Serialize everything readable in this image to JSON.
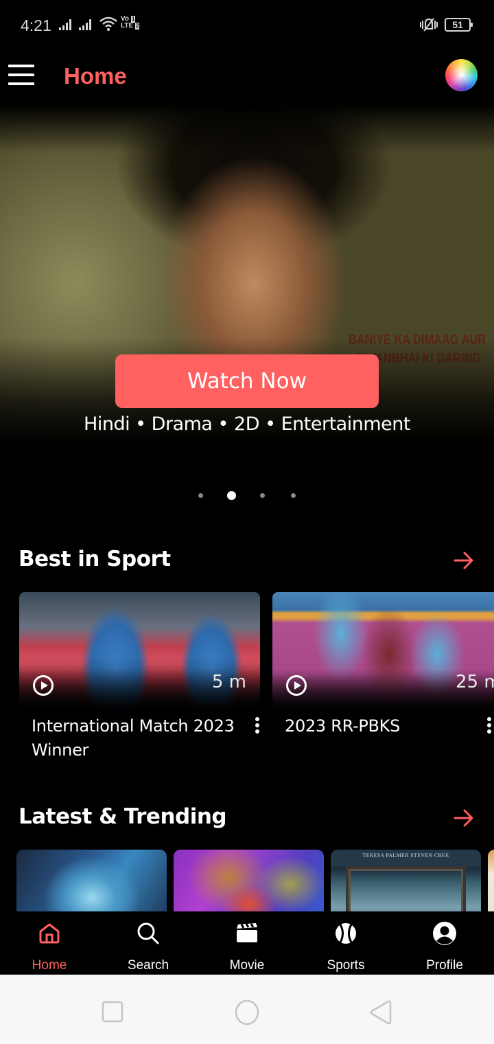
{
  "status_bar": {
    "time": "4:21",
    "volte_top": "Vo",
    "volte_bottom": "LTE",
    "sim_labels": [
      "1",
      "2"
    ],
    "battery": "51",
    "icons": [
      "signal-sim1-icon",
      "signal-sim2-icon",
      "wifi-icon",
      "volte-icon",
      "vibrate-icon",
      "battery-icon"
    ]
  },
  "app_bar": {
    "title": "Home",
    "menu_icon": "hamburger-menu-icon",
    "theme_icon": "color-wheel-icon"
  },
  "hero": {
    "poster_text_line1": "BANIYE KA DIMAAG AUR",
    "poster_text_line2": "MIYANBHAI KI DARING",
    "watch_button": "Watch Now",
    "meta": "Hindi • Drama • 2D • Entertainment",
    "carousel": {
      "total": 4,
      "active_index": 1
    }
  },
  "sections": {
    "best_in_sport": {
      "title": "Best in Sport",
      "see_all_icon": "arrow-right-icon",
      "items": [
        {
          "title": "International Match 2023 Winner",
          "duration": "5 m"
        },
        {
          "title": "2023 RR-PBKS",
          "duration": "25 m"
        }
      ]
    },
    "latest_trending": {
      "title": "Latest & Trending",
      "see_all_icon": "arrow-right-icon",
      "items": [
        {
          "poster": "avatar-poster"
        },
        {
          "poster": "mario-poster"
        },
        {
          "poster": "horror-poster",
          "credits": "TERESA PALMER    STEVEN CREE"
        },
        {
          "poster": "partial-poster"
        }
      ]
    }
  },
  "bottom_nav": {
    "active": "Home",
    "items": [
      {
        "label": "Home",
        "icon": "home-icon"
      },
      {
        "label": "Search",
        "icon": "search-icon"
      },
      {
        "label": "Movie",
        "icon": "clapperboard-icon"
      },
      {
        "label": "Sports",
        "icon": "ball-icon"
      },
      {
        "label": "Profile",
        "icon": "profile-icon"
      }
    ]
  },
  "system_nav": {
    "buttons": [
      "recents-button",
      "home-button",
      "back-button"
    ]
  },
  "colors": {
    "accent": "#ff6060",
    "background": "#000000",
    "text": "#ffffff",
    "system_nav_bg": "#f7f7f7"
  }
}
